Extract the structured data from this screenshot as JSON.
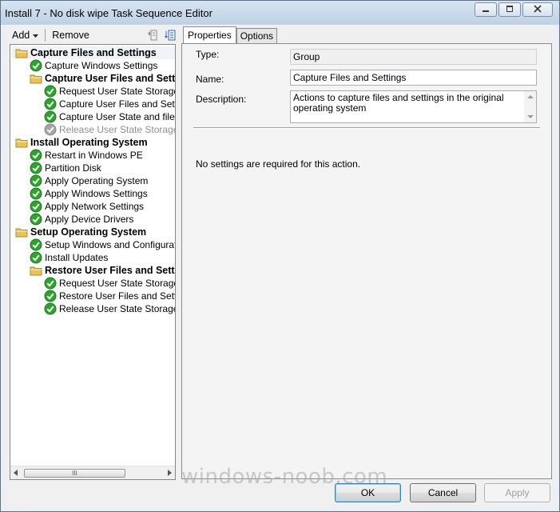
{
  "window": {
    "title": "Install 7 - No disk wipe Task Sequence Editor",
    "minimize_icon": "minimize-icon",
    "maximize_icon": "maximize-icon",
    "close_icon": "close-icon"
  },
  "toolbar": {
    "add_label": "Add",
    "remove_label": "Remove",
    "icons": [
      "move-up-icon",
      "move-down-icon"
    ]
  },
  "tree": {
    "items": [
      {
        "label": "Capture Files and Settings",
        "level": 0,
        "kind": "group",
        "icon": "folder-icon",
        "selected": true
      },
      {
        "label": "Capture Windows Settings",
        "level": 1,
        "kind": "step",
        "icon": "check-icon"
      },
      {
        "label": "Capture User Files and Settings",
        "level": 1,
        "kind": "group",
        "icon": "folder-icon"
      },
      {
        "label": "Request User State Storage",
        "level": 2,
        "kind": "step",
        "icon": "check-icon"
      },
      {
        "label": "Capture User Files and Settings",
        "level": 2,
        "kind": "step",
        "icon": "check-icon"
      },
      {
        "label": "Capture User State and files in",
        "level": 2,
        "kind": "step",
        "icon": "check-icon"
      },
      {
        "label": "Release User State Storage",
        "level": 2,
        "kind": "disabled",
        "icon": "check-disabled-icon"
      },
      {
        "label": "Install Operating System",
        "level": 0,
        "kind": "group",
        "icon": "folder-icon"
      },
      {
        "label": "Restart in Windows PE",
        "level": 1,
        "kind": "step",
        "icon": "check-icon"
      },
      {
        "label": "Partition Disk",
        "level": 1,
        "kind": "step",
        "icon": "check-icon"
      },
      {
        "label": "Apply Operating System",
        "level": 1,
        "kind": "step",
        "icon": "check-icon"
      },
      {
        "label": "Apply Windows Settings",
        "level": 1,
        "kind": "step",
        "icon": "check-icon"
      },
      {
        "label": "Apply Network Settings",
        "level": 1,
        "kind": "step",
        "icon": "check-icon"
      },
      {
        "label": "Apply Device Drivers",
        "level": 1,
        "kind": "step",
        "icon": "check-icon"
      },
      {
        "label": "Setup Operating System",
        "level": 0,
        "kind": "group",
        "icon": "folder-icon"
      },
      {
        "label": "Setup Windows and Configuration",
        "level": 1,
        "kind": "step",
        "icon": "check-icon"
      },
      {
        "label": "Install Updates",
        "level": 1,
        "kind": "step",
        "icon": "check-icon"
      },
      {
        "label": "Restore User Files and Settings",
        "level": 1,
        "kind": "group",
        "icon": "folder-icon"
      },
      {
        "label": "Request User State Storage",
        "level": 2,
        "kind": "step",
        "icon": "check-icon"
      },
      {
        "label": "Restore User Files and Settings",
        "level": 2,
        "kind": "step",
        "icon": "check-icon"
      },
      {
        "label": "Release User State Storage",
        "level": 2,
        "kind": "step",
        "icon": "check-icon"
      }
    ],
    "scroll_grip": "III"
  },
  "tabs": [
    {
      "label": "Properties",
      "active": true
    },
    {
      "label": "Options",
      "active": false
    }
  ],
  "properties": {
    "type_label": "Type:",
    "type_value": "Group",
    "name_label": "Name:",
    "name_value": "Capture Files and Settings",
    "description_label": "Description:",
    "description_value": "Actions to capture files and settings in the original operating system",
    "note": "No settings are required  for this action."
  },
  "buttons": {
    "ok": "OK",
    "cancel": "Cancel",
    "apply": "Apply"
  },
  "watermark": "windows-noob.com",
  "colors": {
    "check_green": "#2ea32e",
    "folder_yellow": "#e8c35a",
    "disabled_gray": "#a6a6a6"
  }
}
